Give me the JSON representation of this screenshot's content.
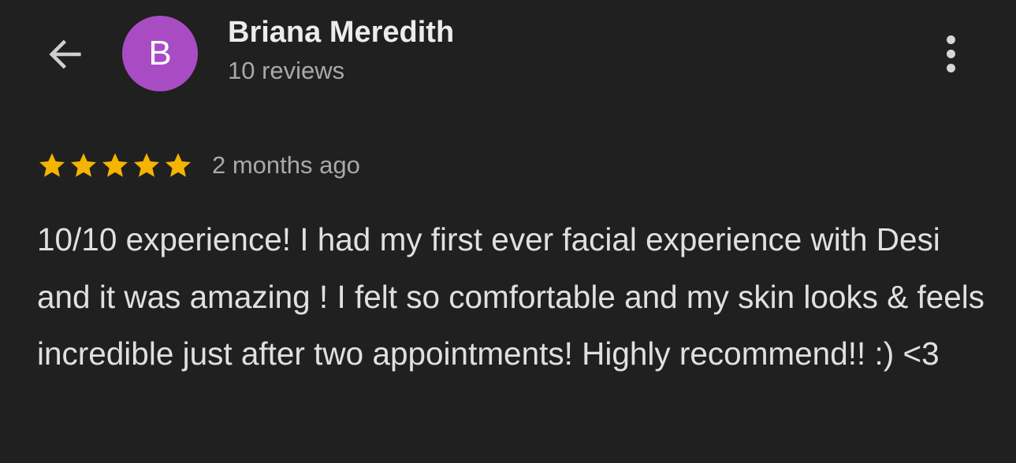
{
  "header": {
    "back_icon": "arrow-left-icon",
    "avatar_letter": "B",
    "avatar_color": "#a94cc4",
    "user_name": "Briana Meredith",
    "review_count": "10 reviews",
    "more_icon": "more-vertical-icon"
  },
  "review": {
    "rating": 5,
    "rating_max": 5,
    "star_color": "#f4b400",
    "date": "2 months ago",
    "text": "10/10 experience! I had my first ever facial experience with Desi and it was amazing ! I felt so comfortable and my skin looks & feels incredible just after two appointments! Highly recommend!! :) <3"
  }
}
